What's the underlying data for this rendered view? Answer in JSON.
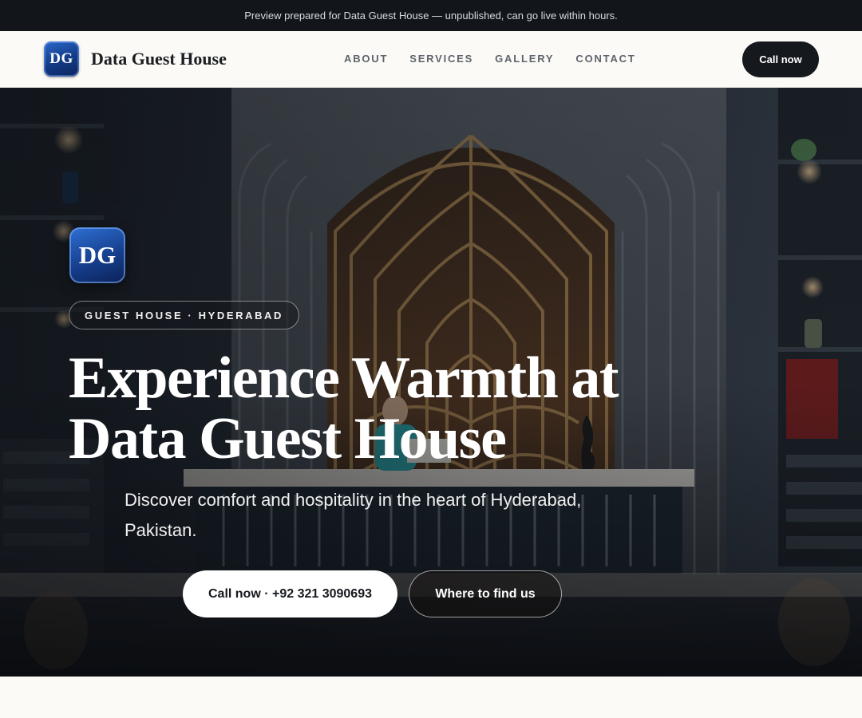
{
  "topbar": {
    "message": "Preview prepared for Data Guest House — unpublished, can go live within hours."
  },
  "nav": {
    "logo_initials": "DG",
    "brand": "Data Guest House",
    "links": [
      "ABOUT",
      "SERVICES",
      "GALLERY",
      "CONTACT"
    ],
    "cta": "Call now"
  },
  "hero": {
    "badge_initials": "DG",
    "eyebrow": "GUEST HOUSE · HYDERABAD",
    "headline_line1": "Experience Warmth at",
    "headline_line2": "Data Guest House",
    "subline": "Discover comfort and hospitality in the heart of Hyderabad, Pakistan.",
    "primary_button": "Call now · +92 321 3090693",
    "secondary_button": "Where to find us"
  },
  "colors": {
    "topbar_bg": "#12151a",
    "nav_bg": "#fbfaf6",
    "cta_bg": "#15181d",
    "badge_blue": "#163f8e",
    "lattice_gold": "#b08a55"
  }
}
